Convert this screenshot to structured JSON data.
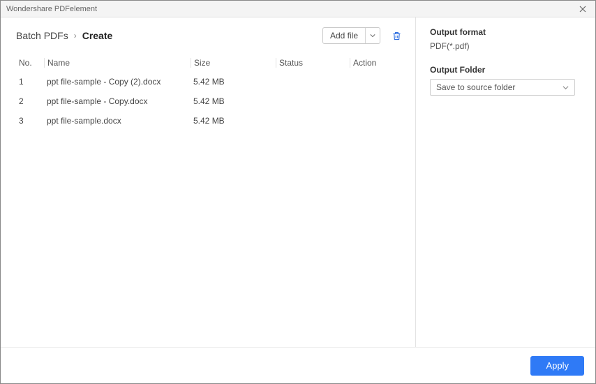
{
  "window": {
    "title": "Wondershare PDFelement"
  },
  "breadcrumb": {
    "root": "Batch PDFs",
    "current": "Create"
  },
  "toolbar": {
    "add_file_label": "Add file"
  },
  "table": {
    "headers": {
      "no": "No.",
      "name": "Name",
      "size": "Size",
      "status": "Status",
      "action": "Action"
    },
    "rows": [
      {
        "no": "1",
        "name": "ppt file-sample - Copy (2).docx",
        "size": "5.42 MB",
        "status": "",
        "action": ""
      },
      {
        "no": "2",
        "name": "ppt file-sample - Copy.docx",
        "size": "5.42 MB",
        "status": "",
        "action": ""
      },
      {
        "no": "3",
        "name": "ppt file-sample.docx",
        "size": "5.42 MB",
        "status": "",
        "action": ""
      }
    ]
  },
  "rightpanel": {
    "output_format_label": "Output format",
    "output_format_value": "PDF(*.pdf)",
    "output_folder_label": "Output Folder",
    "output_folder_value": "Save to source folder"
  },
  "footer": {
    "apply_label": "Apply"
  }
}
